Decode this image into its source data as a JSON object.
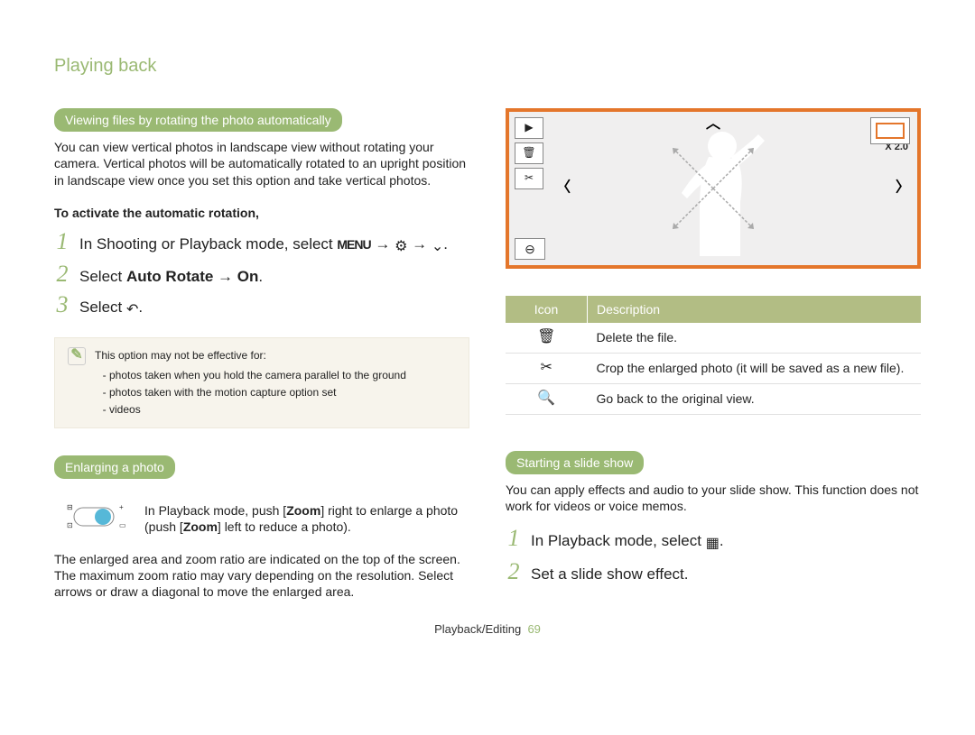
{
  "pageTitle": "Playing back",
  "left": {
    "pillAutoRotate": "Viewing files by rotating the photo automatically",
    "autoRotateIntro": "You can view vertical photos in landscape view without rotating your camera. Vertical photos will be automatically rotated to an upright position in landscape view once you set this option and take vertical photos.",
    "activateHeading": "To activate the automatic rotation,",
    "step1_a": "In Shooting or Playback mode, select ",
    "step1_menu": "MENU",
    "step1_arrow1": " → ",
    "step1_gearArrow": " → ",
    "step1_down": ".",
    "step2_a": "Select ",
    "step2_b": "Auto Rotate",
    "step2_c": " → ",
    "step2_d": "On",
    "step2_e": ".",
    "step3_a": "Select ",
    "step3_b": ".",
    "noteLead": "This option may not be effective for:",
    "noteItems": [
      "photos taken when you hold the camera parallel to the ground",
      "photos taken with the motion capture option set",
      "videos"
    ],
    "pillEnlarge": "Enlarging a photo",
    "enlargePush_a": "In Playback mode, push [",
    "enlargePush_b": "Zoom",
    "enlargePush_c": "] right to enlarge a photo (push [",
    "enlargePush_d": "Zoom",
    "enlargePush_e": "] left to reduce a photo).",
    "enlargeBody": "The enlarged area and zoom ratio are indicated on the top of the screen. The maximum zoom ratio may vary depending on the resolution. Select arrows or draw a diagonal to move the enlarged area."
  },
  "right": {
    "zoomLabel": "X 2.0",
    "tableHead1": "Icon",
    "tableHead2": "Description",
    "rows": [
      {
        "iconName": "trash-icon",
        "glyph": "🗑",
        "desc": "Delete the file."
      },
      {
        "iconName": "crop-icon",
        "glyph": "✂",
        "desc": "Crop the enlarged photo (it will be saved as a new file)."
      },
      {
        "iconName": "magnify-icon",
        "glyph": "🔍",
        "desc": "Go back to the original view."
      }
    ],
    "pillSlideshow": "Starting a slide show",
    "slideshowIntro": "You can apply effects and audio to your slide show. This function does not work for videos or voice memos.",
    "slideStep1_a": "In Playback mode, select ",
    "slideStep1_b": ".",
    "slideStep2": "Set a slide show effect."
  },
  "footer": {
    "section": "Playback/Editing",
    "page": "69"
  }
}
